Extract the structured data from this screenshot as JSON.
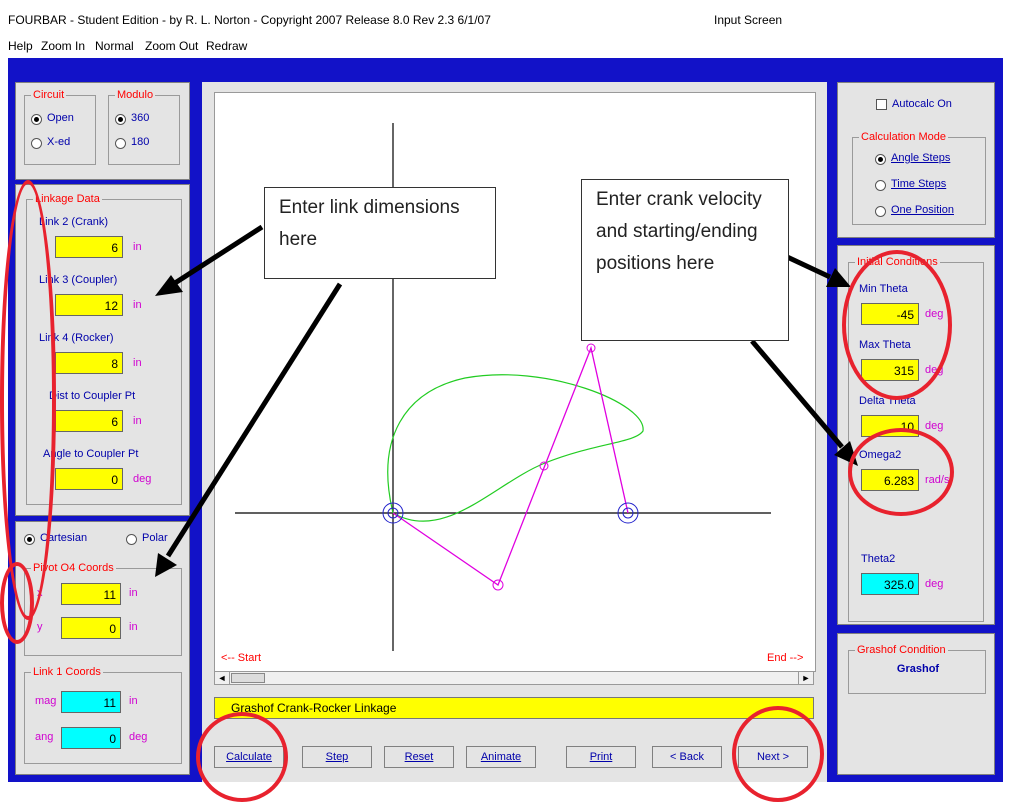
{
  "window": {
    "title": "FOURBAR - Student Edition - by R. L. Norton - Copyright 2007   Release 8.0   Rev 2.3   6/1/07",
    "screen_name": "Input Screen"
  },
  "menu": [
    "Help",
    "Zoom In",
    "Normal",
    "Zoom Out",
    "Redraw"
  ],
  "left": {
    "circuit": {
      "title": "Circuit",
      "options": [
        "Open",
        "X-ed"
      ],
      "selected": "Open"
    },
    "modulo": {
      "title": "Modulo",
      "options": [
        "360",
        "180"
      ],
      "selected": "360"
    },
    "linkage": {
      "title": "Linkage Data",
      "fields": [
        {
          "label": "Link 2 (Crank)",
          "value": "6",
          "unit": "in"
        },
        {
          "label": "Link 3 (Coupler)",
          "value": "12",
          "unit": "in"
        },
        {
          "label": "Link 4 (Rocker)",
          "value": "8",
          "unit": "in"
        },
        {
          "label": "Dist to Coupler Pt",
          "value": "6",
          "unit": "in"
        },
        {
          "label": "Angle to Coupler Pt",
          "value": "0",
          "unit": "deg"
        }
      ]
    },
    "coord_system": {
      "options": [
        "Cartesian",
        "Polar"
      ],
      "selected": "Cartesian"
    },
    "pivot": {
      "title": "Pivot O4 Coords",
      "x_label": "x",
      "x": "11",
      "x_unit": "in",
      "y_label": "y",
      "y": "0",
      "y_unit": "in"
    },
    "link1": {
      "title": "Link 1 Coords",
      "mag_label": "mag",
      "mag": "11",
      "mag_unit": "in",
      "ang_label": "ang",
      "ang": "0",
      "ang_unit": "deg"
    }
  },
  "plot": {
    "start_label": "<-- Start",
    "end_label": "End -->",
    "status": "Grashof Crank-Rocker Linkage"
  },
  "buttons": [
    "Calculate",
    "Step",
    "Reset",
    "Animate",
    "Print",
    "< Back",
    "Next >"
  ],
  "right": {
    "autocalc": {
      "label": "Autocalc On",
      "checked": false
    },
    "calc_mode": {
      "title": "Calculation Mode",
      "options": [
        "Angle Steps",
        "Time Steps",
        "One Position"
      ],
      "selected": "Angle Steps"
    },
    "initial": {
      "title": "Initial Conditions",
      "fields": [
        {
          "label": "Min Theta",
          "value": "-45",
          "unit": "deg"
        },
        {
          "label": "Max Theta",
          "value": "315",
          "unit": "deg"
        },
        {
          "label": "Delta Theta",
          "value": "10",
          "unit": "deg"
        },
        {
          "label": "Omega2",
          "value": "6.283",
          "unit": "rad/s"
        }
      ],
      "theta2_label": "Theta2",
      "theta2": "325.0",
      "theta2_unit": "deg"
    },
    "grashof": {
      "title": "Grashof Condition",
      "value": "Grashof"
    }
  },
  "callouts": {
    "link": "Enter link dimensions here",
    "crank": "Enter crank velocity and starting/ending positions here"
  },
  "colors": {
    "background_blue": "#1212c8",
    "input_yellow": "#ffff00",
    "output_cyan": "#00ffff",
    "annotation_red": "#e8222e",
    "linkage_magenta": "#e000e0",
    "coupler_curve_green": "#22cc22"
  }
}
